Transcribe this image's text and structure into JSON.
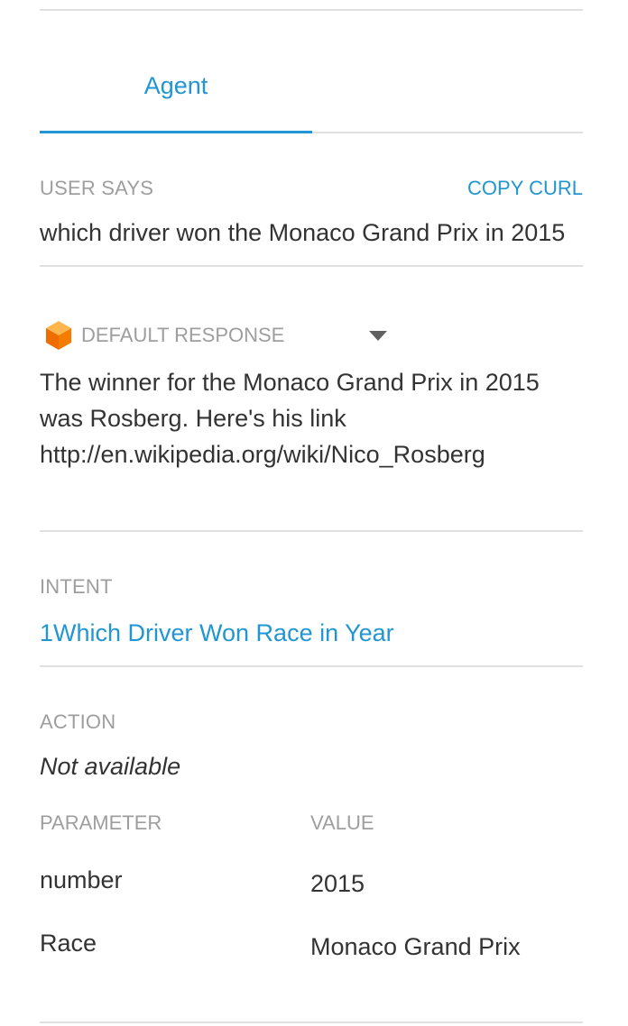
{
  "tabs": {
    "agent_label": "Agent"
  },
  "user_says": {
    "label": "USER SAYS",
    "copy_curl_label": "COPY CURL",
    "query": "which driver won the Monaco Grand Prix in 2015"
  },
  "default_response": {
    "icon": "orange-cube-icon",
    "label": "DEFAULT RESPONSE",
    "line1": "The winner for the Monaco Grand Prix in 2015",
    "line2": "was Rosberg. Here's his link",
    "line3": "http://en.wikipedia.org/wiki/Nico_Rosberg"
  },
  "intent": {
    "label": "INTENT",
    "value": "1Which Driver Won Race in Year"
  },
  "action": {
    "label": "ACTION",
    "value": "Not available"
  },
  "parameters": {
    "param_header": "PARAMETER",
    "value_header": "VALUE",
    "rows": [
      {
        "name": "number",
        "value": "2015"
      },
      {
        "name": "Race",
        "value": "Monaco Grand Prix"
      }
    ]
  },
  "colors": {
    "accent": "#2196d3",
    "label_gray": "#9e9e9e",
    "text": "#333333",
    "divider": "#e0e0e0",
    "cube_orange": "#f57c00"
  }
}
